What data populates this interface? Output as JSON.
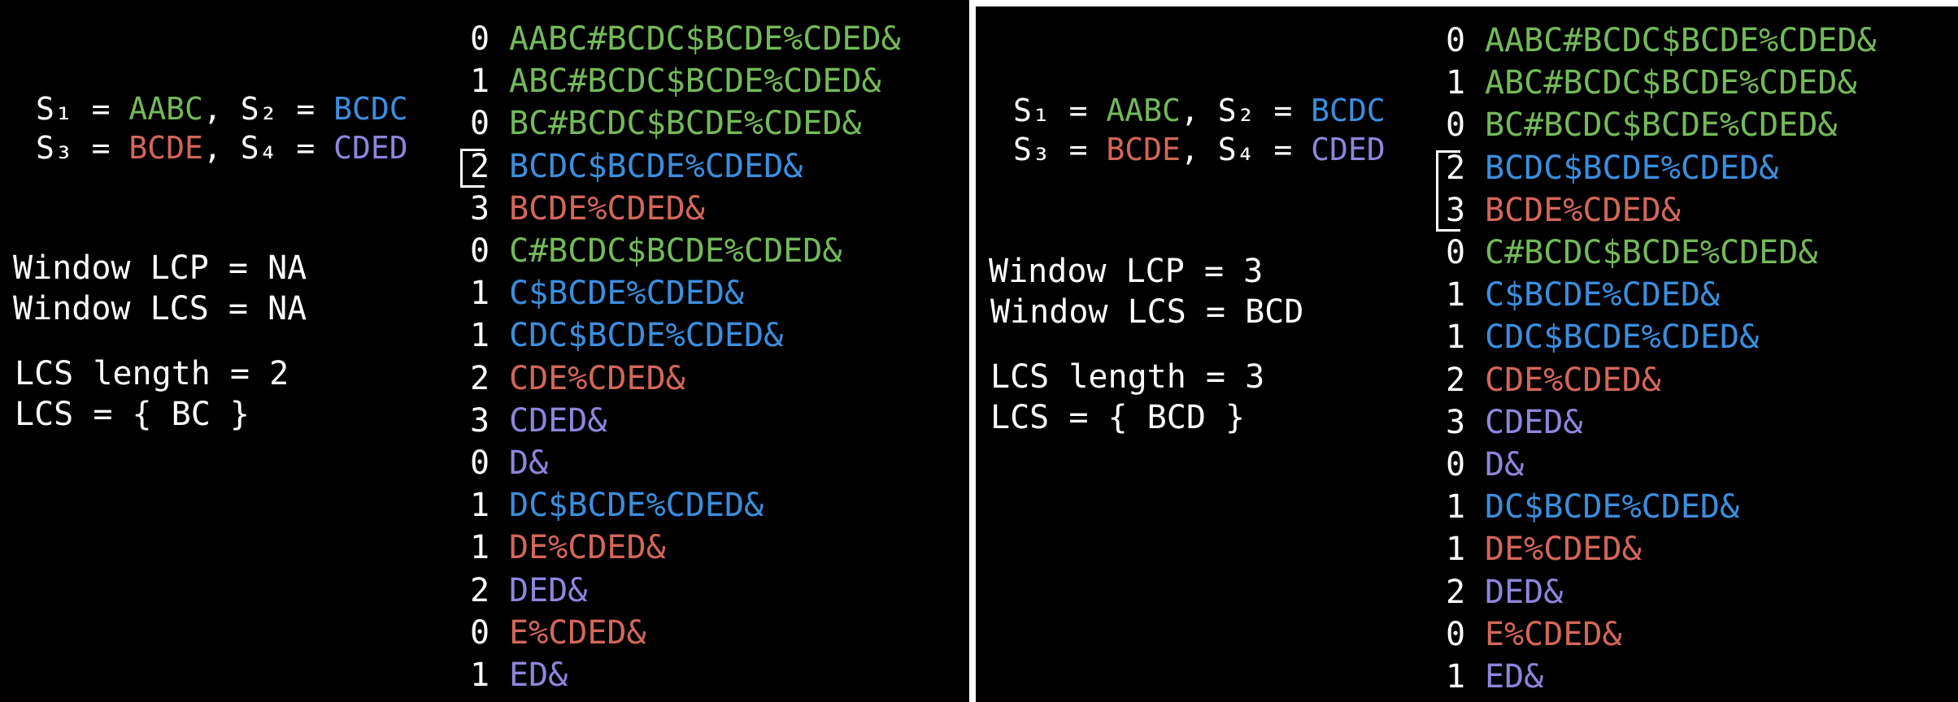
{
  "strings": [
    {
      "label": "S₁",
      "value": "AABC",
      "color": "#74b95a"
    },
    {
      "label": "S₂",
      "value": "BCDC",
      "color": "#3b8ede"
    },
    {
      "label": "S₃",
      "value": "BCDE",
      "color": "#d4665a"
    },
    {
      "label": "S₄",
      "value": "CDED",
      "color": "#8e85dc"
    }
  ],
  "colors": {
    "green": "#74b95a",
    "blue": "#3b8ede",
    "red": "#d4665a",
    "purple": "#8e85dc"
  },
  "panels": [
    {
      "window_lcp": "Window LCP = NA",
      "window_lcs": "Window LCS = NA",
      "lcs_length": "LCS length = 2",
      "lcs": "LCS = { BC }",
      "bracket_rows": [
        3
      ]
    },
    {
      "window_lcp": "Window LCP = 3",
      "window_lcs": "Window LCS = BCD",
      "lcs_length": "LCS length = 3",
      "lcs": "LCS = { BCD }",
      "bracket_rows": [
        3,
        4
      ]
    }
  ],
  "suffix_table": [
    {
      "lcp": "0",
      "suffix": "AABC#BCDC$BCDE%CDED&",
      "color": "green"
    },
    {
      "lcp": "1",
      "suffix": "ABC#BCDC$BCDE%CDED&",
      "color": "green"
    },
    {
      "lcp": "0",
      "suffix": "BC#BCDC$BCDE%CDED&",
      "color": "green"
    },
    {
      "lcp": "2",
      "suffix": "BCDC$BCDE%CDED&",
      "color": "blue"
    },
    {
      "lcp": "3",
      "suffix": "BCDE%CDED&",
      "color": "red"
    },
    {
      "lcp": "0",
      "suffix": "C#BCDC$BCDE%CDED&",
      "color": "green"
    },
    {
      "lcp": "1",
      "suffix": "C$BCDE%CDED&",
      "color": "blue"
    },
    {
      "lcp": "1",
      "suffix": "CDC$BCDE%CDED&",
      "color": "blue"
    },
    {
      "lcp": "2",
      "suffix": "CDE%CDED&",
      "color": "red"
    },
    {
      "lcp": "3",
      "suffix": "CDED&",
      "color": "purple"
    },
    {
      "lcp": "0",
      "suffix": "D&",
      "color": "purple"
    },
    {
      "lcp": "1",
      "suffix": "DC$BCDE%CDED&",
      "color": "blue"
    },
    {
      "lcp": "1",
      "suffix": "DE%CDED&",
      "color": "red"
    },
    {
      "lcp": "2",
      "suffix": "DED&",
      "color": "purple"
    },
    {
      "lcp": "0",
      "suffix": "E%CDED&",
      "color": "red"
    },
    {
      "lcp": "1",
      "suffix": "ED&",
      "color": "purple"
    }
  ]
}
